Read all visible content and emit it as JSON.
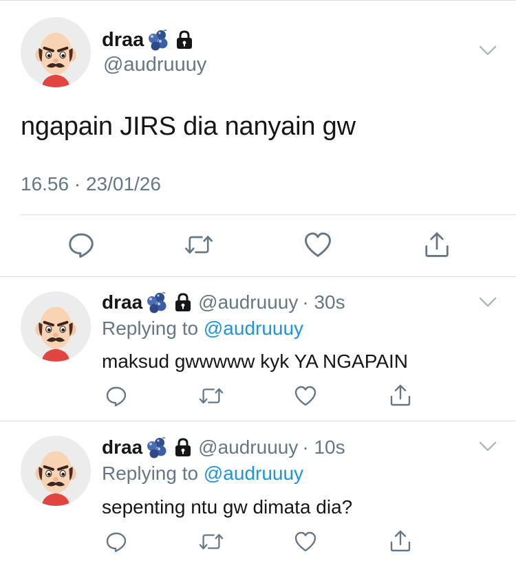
{
  "main_tweet": {
    "display_name": "draa",
    "handle": "@audruuuy",
    "text": "ngapain JIRS dia nanyain gw",
    "timestamp": "16.56 · 23/01/26"
  },
  "replies": [
    {
      "display_name": "draa",
      "handle": "@audruuuy",
      "time": "· 30s",
      "replying_prefix": "Replying to ",
      "replying_to": "@audruuuy",
      "text": "maksud gwwwww kyk YA NGAPAIN"
    },
    {
      "display_name": "draa",
      "handle": "@audruuuy",
      "time": "· 10s",
      "replying_prefix": "Replying to ",
      "replying_to": "@audruuuy",
      "text": "sepenting ntu gw dimata dia?"
    }
  ],
  "icons": {
    "reply": "reply-icon",
    "retweet": "retweet-icon",
    "like": "heart-icon",
    "share": "share-icon",
    "lock": "lock-icon",
    "emoji": "blueberries-emoji-icon",
    "menu": "chevron-down-icon"
  },
  "colors": {
    "text": "#14171a",
    "secondary": "#657786",
    "link": "#1b95e0",
    "divider": "#dcdcdc"
  }
}
